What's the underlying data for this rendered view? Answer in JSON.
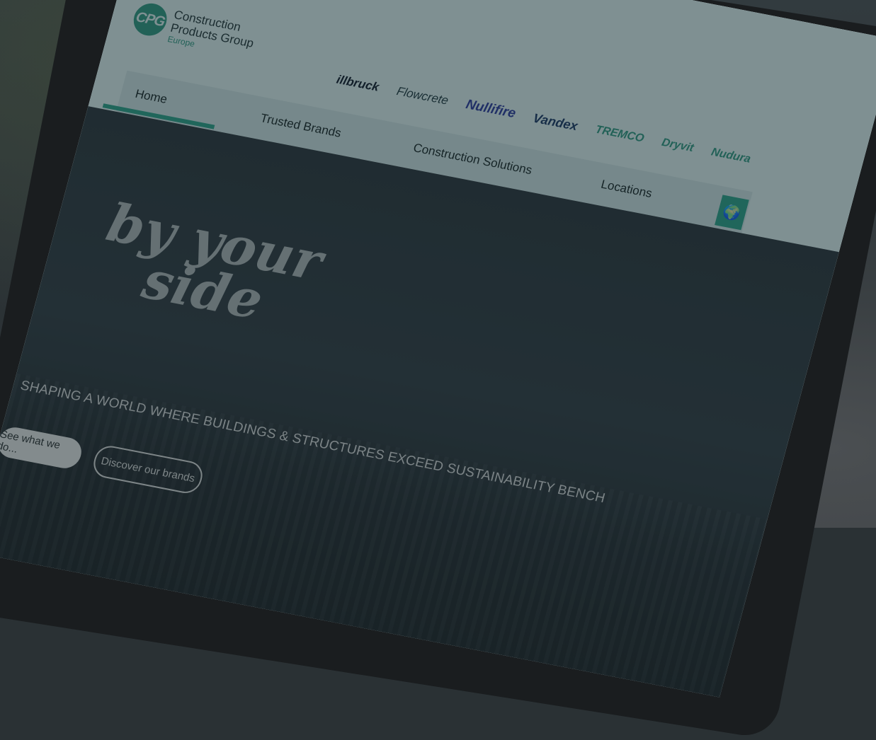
{
  "logo": {
    "mark": "CPG",
    "line1": "Construction",
    "line2": "Products Group",
    "sub": "Europe"
  },
  "brands": [
    "illbruck",
    "Flowcrete",
    "Nullifire",
    "Vandex",
    "TREMCO",
    "Dryvit",
    "Nudura"
  ],
  "nav": {
    "items": [
      "Home",
      "Trusted Brands",
      "Construction Solutions",
      "Locations"
    ],
    "active": "Home",
    "globe_icon": "globe-icon"
  },
  "hero": {
    "tagline_line1": "by your",
    "tagline_line2": "side",
    "subhead": "SHAPING A WORLD WHERE BUILDINGS & STRUCTURES EXCEED SUSTAINABILITY BENCH",
    "primary_button": "See what we do...",
    "secondary_button": "Discover our brands"
  },
  "colors": {
    "accent": "#2aa38d",
    "header_bg": "#d7eef0",
    "nav_bg": "#c6e1e3",
    "hero_bg": "#2b3a42"
  }
}
